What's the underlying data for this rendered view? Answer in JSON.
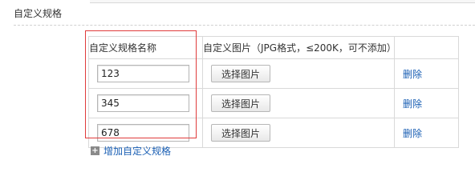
{
  "section": {
    "title": "自定义规格"
  },
  "table": {
    "headers": {
      "name": "自定义规格名称",
      "image": "自定义图片（JPG格式，≤200K，可不添加）"
    },
    "rows": [
      {
        "value": "123",
        "button": "选择图片",
        "delete": "删除"
      },
      {
        "value": "345",
        "button": "选择图片",
        "delete": "删除"
      },
      {
        "value": "678",
        "button": "选择图片",
        "delete": "删除"
      }
    ]
  },
  "add_link": {
    "label": "增加自定义规格",
    "icon": "plus-icon"
  },
  "colors": {
    "highlight_border": "#e03b3b",
    "link": "#1a5fb4"
  }
}
